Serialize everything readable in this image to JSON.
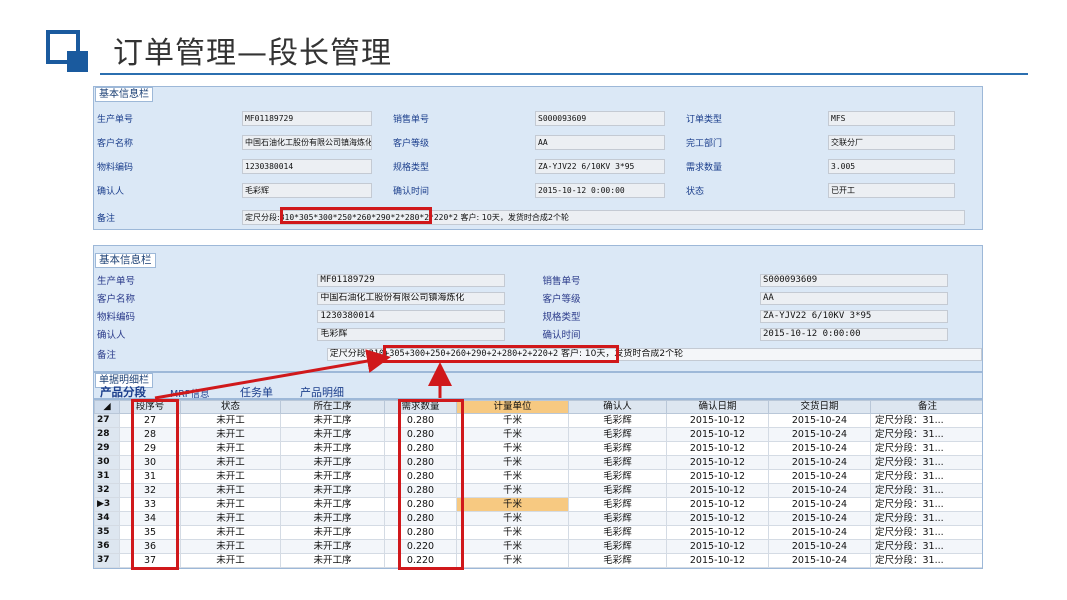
{
  "slide": {
    "title": "订单管理—段长管理"
  },
  "panel1": {
    "legend": "基本信息栏",
    "rows": [
      {
        "a_label": "生产单号",
        "a_value": "MF01189729",
        "b_label": "销售单号",
        "b_value": "S000093609",
        "c_label": "订单类型",
        "c_value": "MFS"
      },
      {
        "a_label": "客户名称",
        "a_value": "中国石油化工股份有限公司镇海炼化",
        "b_label": "客户等级",
        "b_value": "AA",
        "c_label": "完工部门",
        "c_value": "交联分厂"
      },
      {
        "a_label": "物料编码",
        "a_value": "1230380014",
        "b_label": "规格类型",
        "b_value": "ZA-YJV22 6/10KV 3*95",
        "c_label": "需求数量",
        "c_value": "3.005"
      },
      {
        "a_label": "确认人",
        "a_value": "毛彩辉",
        "b_label": "确认时间",
        "b_value": "2015-10-12 0:00:00",
        "c_label": "状态",
        "c_value": "已开工"
      }
    ],
    "remark_label": "备注",
    "remark_prefix": "定尺分段:",
    "remark_hl": "310*305*300*250*260*290*2*280*2*220*2",
    "remark_suffix": "客户: 10天，发货时合成2个轮"
  },
  "panel2": {
    "legend": "基本信息栏",
    "rows": [
      {
        "a_label": "生产单号",
        "a_value": "MF01189729",
        "b_label": "销售单号",
        "b_value": "S000093609"
      },
      {
        "a_label": "客户名称",
        "a_value": "中国石油化工股份有限公司镇海炼化",
        "b_label": "客户等级",
        "b_value": "AA"
      },
      {
        "a_label": "物料编码",
        "a_value": "1230380014",
        "b_label": "规格类型",
        "b_value": "ZA-YJV22 6/10KV 3*95"
      },
      {
        "a_label": "确认人",
        "a_value": "毛彩辉",
        "b_label": "确认时间",
        "b_value": "2015-10-12 0:00:00"
      }
    ],
    "remark_label": "备注",
    "remark_prefix": "定尺分段:",
    "remark_hl": "310+305+300+250+260+290+2+280+2+220+2",
    "remark_suffix": "客户: 10天，发货时合成2个轮"
  },
  "tabs": {
    "legend": "单据明细栏",
    "items": [
      "产品分段",
      "MRP信息",
      "任务单",
      "产品明细"
    ]
  },
  "grid": {
    "headers": [
      "段序号",
      "状态",
      "所在工序",
      "需求数量",
      "计量单位",
      "确认人",
      "确认日期",
      "交货日期",
      "备注"
    ],
    "rows": [
      {
        "rowno": "27",
        "seq": "27",
        "status": "未开工",
        "proc": "未开工序",
        "qty": "0.280",
        "unit": "千米",
        "confirmer": "毛彩辉",
        "cdate": "2015-10-12",
        "ddate": "2015-10-24",
        "note": "定尺分段：31..."
      },
      {
        "rowno": "28",
        "seq": "28",
        "status": "未开工",
        "proc": "未开工序",
        "qty": "0.280",
        "unit": "千米",
        "confirmer": "毛彩辉",
        "cdate": "2015-10-12",
        "ddate": "2015-10-24",
        "note": "定尺分段：31..."
      },
      {
        "rowno": "29",
        "seq": "29",
        "status": "未开工",
        "proc": "未开工序",
        "qty": "0.280",
        "unit": "千米",
        "confirmer": "毛彩辉",
        "cdate": "2015-10-12",
        "ddate": "2015-10-24",
        "note": "定尺分段：31..."
      },
      {
        "rowno": "30",
        "seq": "30",
        "status": "未开工",
        "proc": "未开工序",
        "qty": "0.280",
        "unit": "千米",
        "confirmer": "毛彩辉",
        "cdate": "2015-10-12",
        "ddate": "2015-10-24",
        "note": "定尺分段：31..."
      },
      {
        "rowno": "31",
        "seq": "31",
        "status": "未开工",
        "proc": "未开工序",
        "qty": "0.280",
        "unit": "千米",
        "confirmer": "毛彩辉",
        "cdate": "2015-10-12",
        "ddate": "2015-10-24",
        "note": "定尺分段：31..."
      },
      {
        "rowno": "32",
        "seq": "32",
        "status": "未开工",
        "proc": "未开工序",
        "qty": "0.280",
        "unit": "千米",
        "confirmer": "毛彩辉",
        "cdate": "2015-10-12",
        "ddate": "2015-10-24",
        "note": "定尺分段：31..."
      },
      {
        "rowno": "▶3",
        "seq": "33",
        "status": "未开工",
        "proc": "未开工序",
        "qty": "0.280",
        "unit": "千米",
        "confirmer": "毛彩辉",
        "cdate": "2015-10-12",
        "ddate": "2015-10-24",
        "note": "定尺分段：31..."
      },
      {
        "rowno": "34",
        "seq": "34",
        "status": "未开工",
        "proc": "未开工序",
        "qty": "0.280",
        "unit": "千米",
        "confirmer": "毛彩辉",
        "cdate": "2015-10-12",
        "ddate": "2015-10-24",
        "note": "定尺分段：31..."
      },
      {
        "rowno": "35",
        "seq": "35",
        "status": "未开工",
        "proc": "未开工序",
        "qty": "0.280",
        "unit": "千米",
        "confirmer": "毛彩辉",
        "cdate": "2015-10-12",
        "ddate": "2015-10-24",
        "note": "定尺分段：31..."
      },
      {
        "rowno": "36",
        "seq": "36",
        "status": "未开工",
        "proc": "未开工序",
        "qty": "0.220",
        "unit": "千米",
        "confirmer": "毛彩辉",
        "cdate": "2015-10-12",
        "ddate": "2015-10-24",
        "note": "定尺分段：31..."
      },
      {
        "rowno": "37",
        "seq": "37",
        "status": "未开工",
        "proc": "未开工序",
        "qty": "0.220",
        "unit": "千米",
        "confirmer": "毛彩辉",
        "cdate": "2015-10-12",
        "ddate": "2015-10-24",
        "note": "定尺分段：31..."
      }
    ]
  },
  "colors": {
    "accent": "#1a5a9e",
    "highlight_box": "#d0181b",
    "column_highlight": "#f7c981",
    "panel_bg": "#dbe8f6"
  }
}
